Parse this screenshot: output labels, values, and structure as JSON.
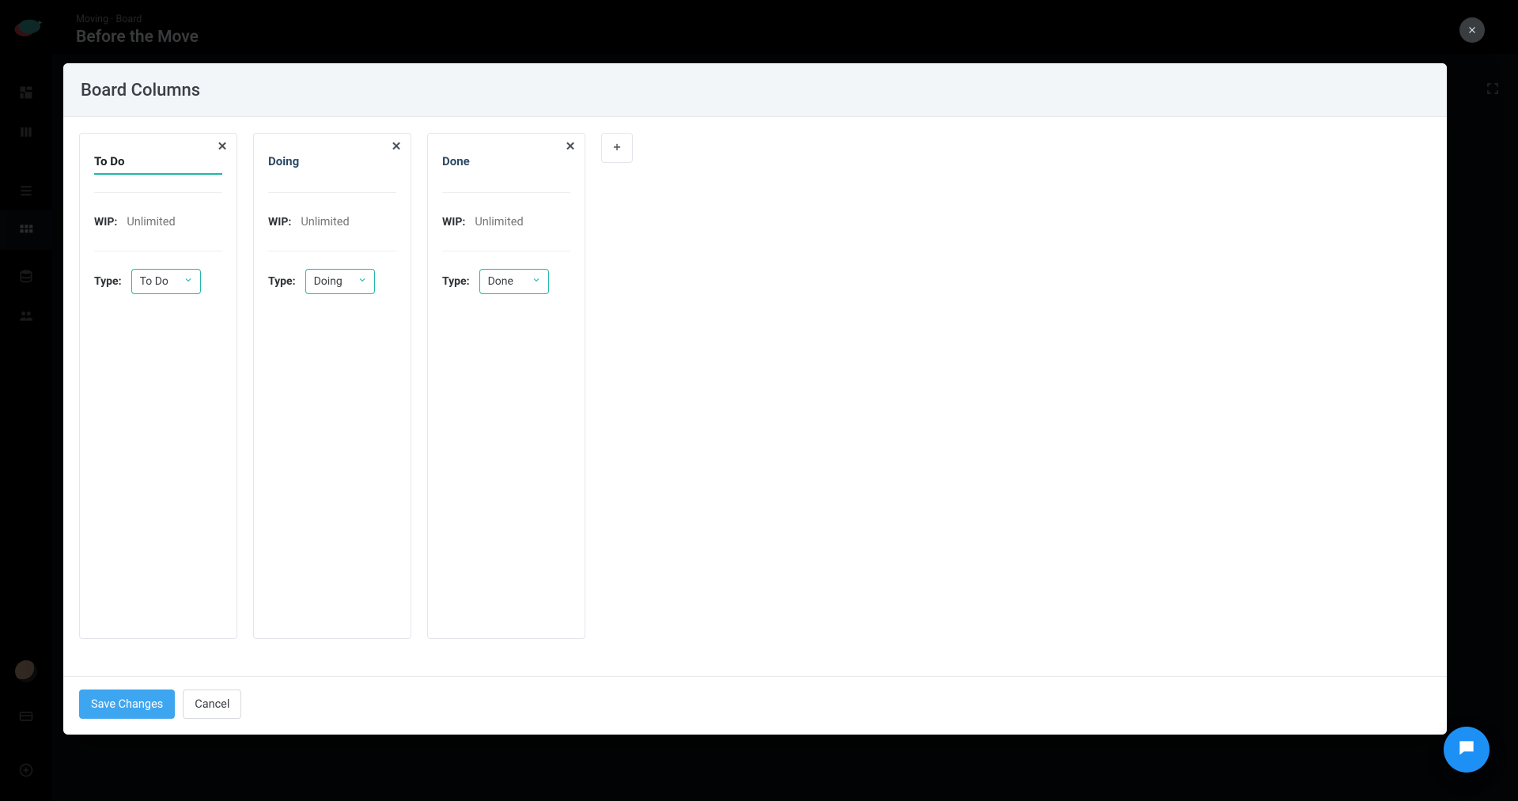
{
  "header": {
    "crumb_project": "Moving",
    "crumb_separator": " · ",
    "crumb_section": "Board",
    "page_title": "Before the Move"
  },
  "modal": {
    "title": "Board Columns",
    "wip_label": "WIP:",
    "wip_placeholder": "Unlimited",
    "type_label": "Type:",
    "save": "Save Changes",
    "cancel": "Cancel"
  },
  "columns": [
    {
      "name": "To Do",
      "name_focused": true,
      "wip": "",
      "type": "To Do"
    },
    {
      "name": "Doing",
      "name_focused": false,
      "wip": "",
      "type": "Doing"
    },
    {
      "name": "Done",
      "name_focused": false,
      "wip": "",
      "type": "Done"
    }
  ],
  "icons": {
    "close": "close-icon",
    "add": "plus-icon",
    "chevron_down": "chevron-down-icon",
    "fullscreen": "fullscreen-icon",
    "chat": "chat-icon"
  }
}
